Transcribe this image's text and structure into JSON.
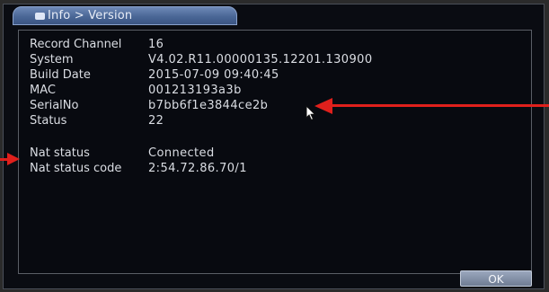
{
  "window": {
    "breadcrumb": "Info > Version"
  },
  "info_rows": [
    {
      "label": "Record Channel",
      "value": "16"
    },
    {
      "label": "System",
      "value": "V4.02.R11.00000135.12201.130900"
    },
    {
      "label": "Build Date",
      "value": "2015-07-09 09:40:45"
    },
    {
      "label": "MAC",
      "value": "001213193a3b"
    },
    {
      "label": "SerialNo",
      "value": "b7bb6f1e3844ce2b"
    },
    {
      "label": "Status",
      "value": "22"
    },
    {
      "label": "Nat status",
      "value": "Connected"
    },
    {
      "label": "Nat status code",
      "value": "2:54.72.86.70/1"
    }
  ],
  "buttons": {
    "ok_label": "OK"
  },
  "colors": {
    "annotation_arrow": "#e0201c",
    "title_bar": "#4a6796",
    "panel_bg": "#080a10"
  },
  "icons": {
    "title": "info-icon",
    "pointer": "mouse-cursor-icon"
  }
}
